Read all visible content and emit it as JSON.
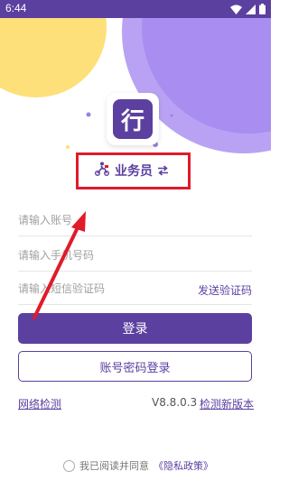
{
  "status_bar": {
    "time": "6:44",
    "wifi_icon": "wifi-icon",
    "signal_icon": "signal-icon",
    "battery_icon": "battery-icon"
  },
  "logo": {
    "char": "行",
    "icon": "app-logo-icon"
  },
  "role_switch": {
    "label": "业务员",
    "rider_icon": "scooter-rider-icon",
    "switch_icon": "swap-arrows-icon"
  },
  "form": {
    "account_placeholder": "请输入账号",
    "phone_placeholder": "请输入手机号码",
    "code_placeholder": "请输入短信验证码",
    "send_code": "发送验证码"
  },
  "buttons": {
    "login": "登录",
    "password_login": "账号密码登录"
  },
  "footer": {
    "network_check": "网络检测",
    "version": "V8.8.0.3",
    "check_update": "检测新版本"
  },
  "agreement": {
    "prefix": "我已阅读并同意",
    "privacy": "《隐私政策》"
  },
  "colors": {
    "primary": "#5b40a0",
    "highlight": "#e01b2a",
    "yellow_blob": "#fde07a",
    "purple_blob": "#a98df0"
  }
}
